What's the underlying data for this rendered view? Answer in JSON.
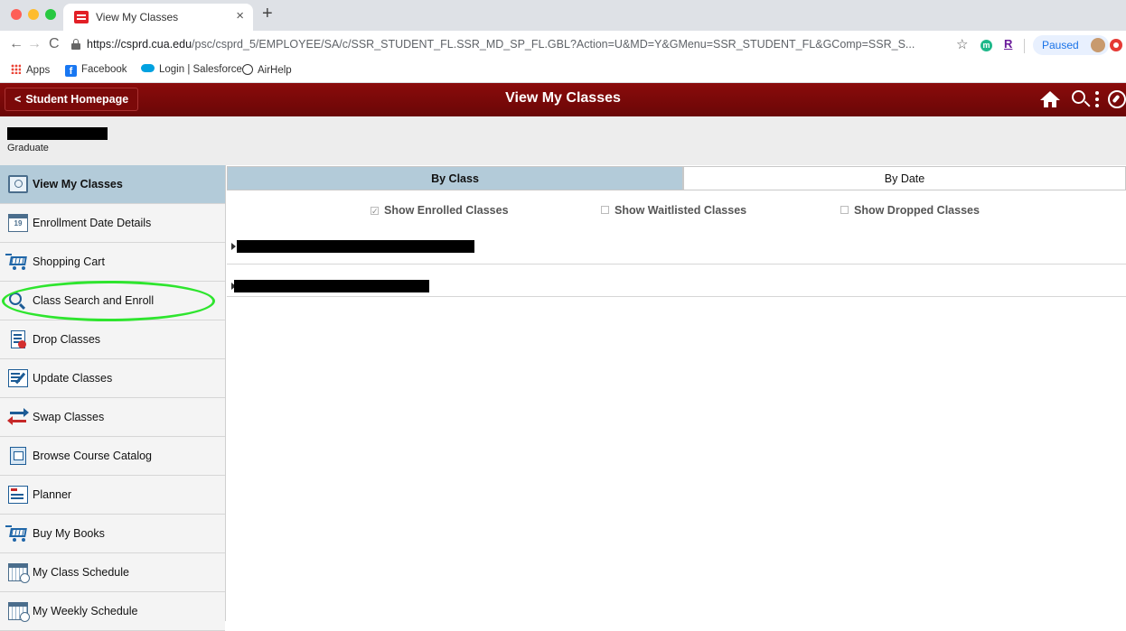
{
  "browser": {
    "tab_title": "View My Classes",
    "tab_close": "×",
    "new_tab": "+",
    "url_host": "https://csprd.cua.edu",
    "url_rest": "/psc/csprd_5/EMPLOYEE/SA/c/SSR_STUDENT_FL.SSR_MD_SP_FL.GBL?Action=U&MD=Y&GMenu=SSR_STUDENT_FL&GComp=SSR_S...",
    "profile_status": "Paused",
    "ext_m_letter": "m",
    "ext_r_letter": "R",
    "bookmarks": [
      {
        "label": "Apps",
        "icon": "apps-grid-icon"
      },
      {
        "label": "Facebook",
        "icon": "facebook-icon"
      },
      {
        "label": "Login | Salesforce",
        "icon": "salesforce-icon"
      },
      {
        "label": "AirHelp",
        "icon": "airhelp-icon"
      }
    ]
  },
  "header": {
    "back_label": "Student Homepage",
    "title": "View My Classes",
    "color": "#7b0909"
  },
  "student": {
    "career": "Graduate"
  },
  "sidebar": {
    "active_color": "#b3cbd9",
    "items": [
      {
        "label": "View My Classes",
        "icon": "view-classes-icon",
        "active": true
      },
      {
        "label": "Enrollment Date Details",
        "icon": "calendar-icon",
        "icon_text": "19"
      },
      {
        "label": "Shopping Cart",
        "icon": "shopping-cart-icon"
      },
      {
        "label": "Class Search and Enroll",
        "icon": "search-icon"
      },
      {
        "label": "Drop Classes",
        "icon": "drop-classes-icon"
      },
      {
        "label": "Update Classes",
        "icon": "update-classes-icon"
      },
      {
        "label": "Swap Classes",
        "icon": "swap-icon"
      },
      {
        "label": "Browse Course Catalog",
        "icon": "catalog-icon"
      },
      {
        "label": "Planner",
        "icon": "planner-icon"
      },
      {
        "label": "Buy My Books",
        "icon": "shopping-cart-icon"
      },
      {
        "label": "My Class Schedule",
        "icon": "schedule-icon"
      },
      {
        "label": "My Weekly Schedule",
        "icon": "schedule-icon"
      }
    ]
  },
  "main": {
    "tabs": [
      {
        "label": "By Class",
        "selected": true
      },
      {
        "label": "By Date",
        "selected": false
      }
    ],
    "filters": [
      {
        "label": "Show Enrolled Classes",
        "checked": true
      },
      {
        "label": "Show Waitlisted Classes",
        "checked": false
      },
      {
        "label": "Show Dropped Classes",
        "checked": false
      }
    ],
    "check_mark": "✓"
  },
  "annotation_color": "#2ee52e"
}
